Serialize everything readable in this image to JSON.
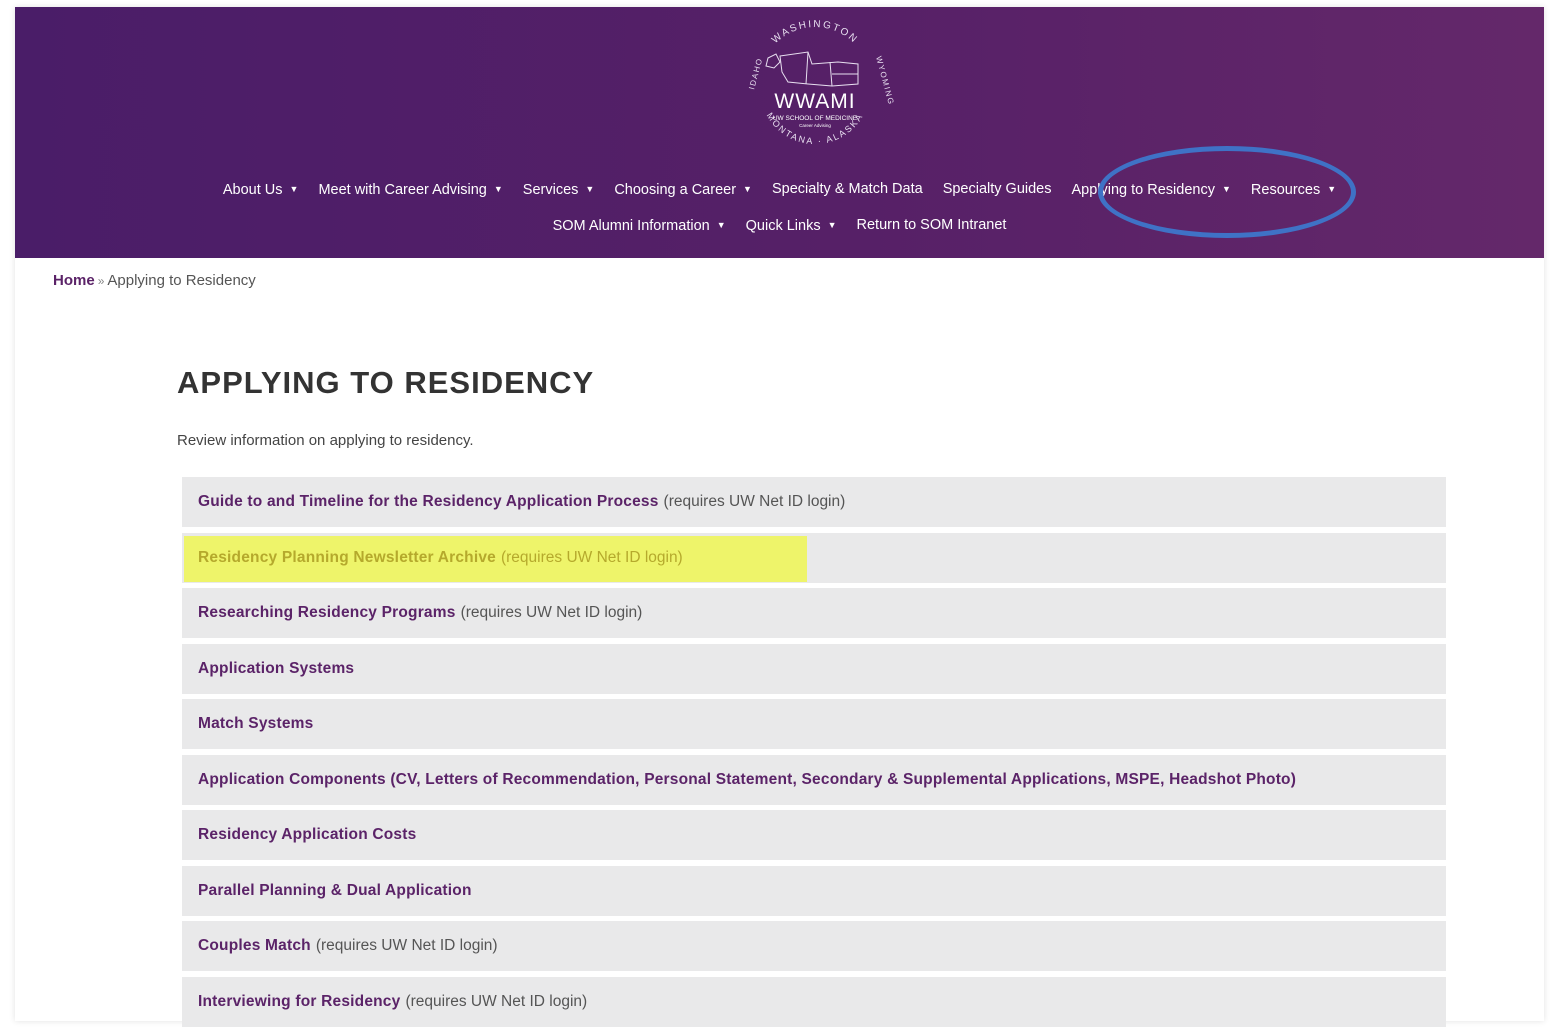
{
  "logo": {
    "arc_top": "WASHINGTON",
    "arc_left": "IDAHO",
    "arc_right": "WYOMING",
    "arc_bottom": "MONTANA · ALASKA",
    "name": "WWAMI",
    "subtitle": "UW SCHOOL OF MEDICINE",
    "tagline": "Career Advising"
  },
  "nav": {
    "row1": [
      {
        "label": "About Us",
        "caret": true
      },
      {
        "label": "Meet with Career Advising",
        "caret": true
      },
      {
        "label": "Services",
        "caret": true
      },
      {
        "label": "Choosing a Career",
        "caret": true
      },
      {
        "label": "Specialty & Match Data",
        "caret": false
      },
      {
        "label": "Specialty Guides",
        "caret": false
      },
      {
        "label": "Applying to Residency",
        "caret": true
      },
      {
        "label": "Resources",
        "caret": true
      }
    ],
    "row2": [
      {
        "label": "SOM Alumni Information",
        "caret": true
      },
      {
        "label": "Quick Links",
        "caret": true
      },
      {
        "label": "Return to SOM Intranet",
        "caret": false
      }
    ],
    "caret_glyph": "▼"
  },
  "breadcrumb": {
    "home": "Home",
    "separator": "»",
    "current": "Applying to Residency"
  },
  "page": {
    "title": "APPLYING TO RESIDENCY",
    "intro": "Review information on applying to residency."
  },
  "accordion": [
    {
      "title": "Guide to and Timeline for the Residency Application Process",
      "note": "(requires UW Net ID login)"
    },
    {
      "title": "Residency Planning Newsletter Archive",
      "note": "(requires UW Net ID login)",
      "highlighted": true
    },
    {
      "title": "Researching Residency Programs",
      "note": "(requires UW Net ID login)"
    },
    {
      "title": "Application Systems",
      "note": ""
    },
    {
      "title": "Match Systems",
      "note": ""
    },
    {
      "title": "Application Components (CV, Letters of Recommendation, Personal Statement, Secondary & Supplemental Applications, MSPE, Headshot Photo)",
      "note": ""
    },
    {
      "title": "Residency Application Costs",
      "note": ""
    },
    {
      "title": "Parallel Planning & Dual Application",
      "note": ""
    },
    {
      "title": "Couples Match",
      "note": "(requires UW Net ID login)"
    },
    {
      "title": "Interviewing for Residency",
      "note": "(requires UW Net ID login)"
    }
  ],
  "colors": {
    "header_start": "#4a1d68",
    "header_end": "#64286a",
    "link_purple": "#5b2368",
    "annotation_circle": "#3f72c6",
    "annotation_highlight": "#eef46a",
    "accordion_bg": "#e9e9ea"
  }
}
